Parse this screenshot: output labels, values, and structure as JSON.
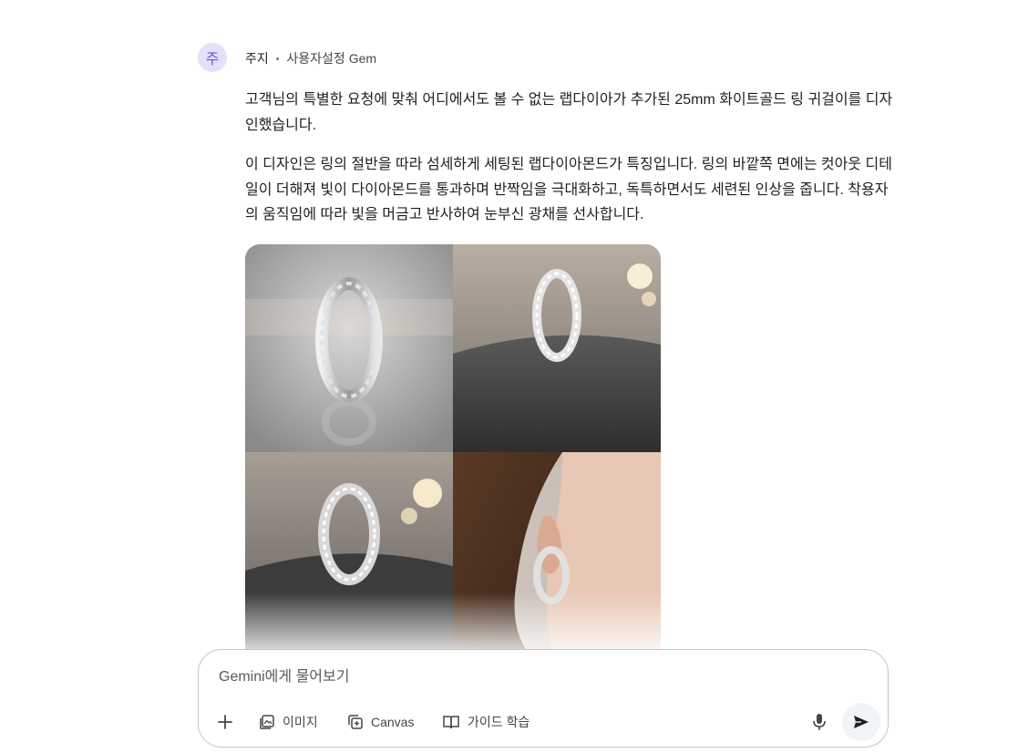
{
  "message": {
    "avatar_letter": "주",
    "author": "주지",
    "separator": "•",
    "gem_label": "사용자설정 Gem",
    "paragraphs": [
      "고객님의 특별한 요청에 맞춰 어디에서도 볼 수 없는 랩다이아가 추가된 25mm 화이트골드 링 귀걸이를 디자인했습니다.",
      "이 디자인은 링의 절반을 따라 섬세하게 세팅된 랩다이아몬드가 특징입니다. 링의 바깥쪽 면에는 컷아웃 디테일이 더해져 빛이 다이아몬드를 통과하며 반짝임을 극대화하고, 독특하면서도 세련된 인상을 줍니다. 착용자의 움직임에 따라 빛을 머금고 반사하여 눈부신 광채를 선사합니다."
    ],
    "images": [
      {
        "alt": "earring-on-gray-gradient"
      },
      {
        "alt": "earring-on-gray-cushion"
      },
      {
        "alt": "earring-on-cushion-with-lights"
      },
      {
        "alt": "earring-worn-on-ear"
      }
    ]
  },
  "composer": {
    "placeholder": "Gemini에게 물어보기",
    "tools": {
      "image": "이미지",
      "canvas": "Canvas",
      "guided_learning": "가이드 학습"
    }
  },
  "icons": {
    "add": "plus-icon",
    "image": "image-icon",
    "canvas": "canvas-icon",
    "guided_learning": "book-icon",
    "mic": "mic-icon",
    "send": "send-icon"
  }
}
